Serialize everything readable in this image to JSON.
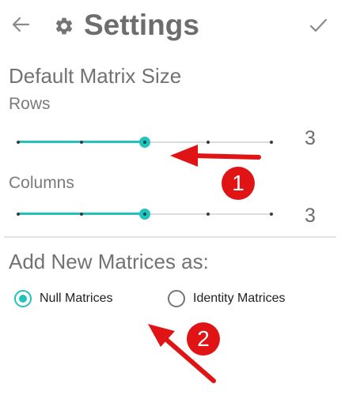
{
  "header": {
    "title": "Settings",
    "back_icon": "arrow-left-icon",
    "settings_icon": "gear-icon",
    "confirm_icon": "checkmark-icon"
  },
  "matrix_size": {
    "section_title": "Default Matrix Size",
    "rows": {
      "label": "Rows",
      "value": "3",
      "selected_index": 2,
      "max_index": 4
    },
    "columns": {
      "label": "Columns",
      "value": "3",
      "selected_index": 2,
      "max_index": 4
    }
  },
  "add_matrices": {
    "section_title": "Add New Matrices as:",
    "options": [
      {
        "label": "Null Matrices",
        "checked": true
      },
      {
        "label": "Identity Matrices",
        "checked": false
      }
    ]
  },
  "annotations": {
    "badge_1": "1",
    "badge_2": "2",
    "color": "#e01414"
  },
  "colors": {
    "accent": "#22c3bd",
    "text_gray": "#757575"
  }
}
